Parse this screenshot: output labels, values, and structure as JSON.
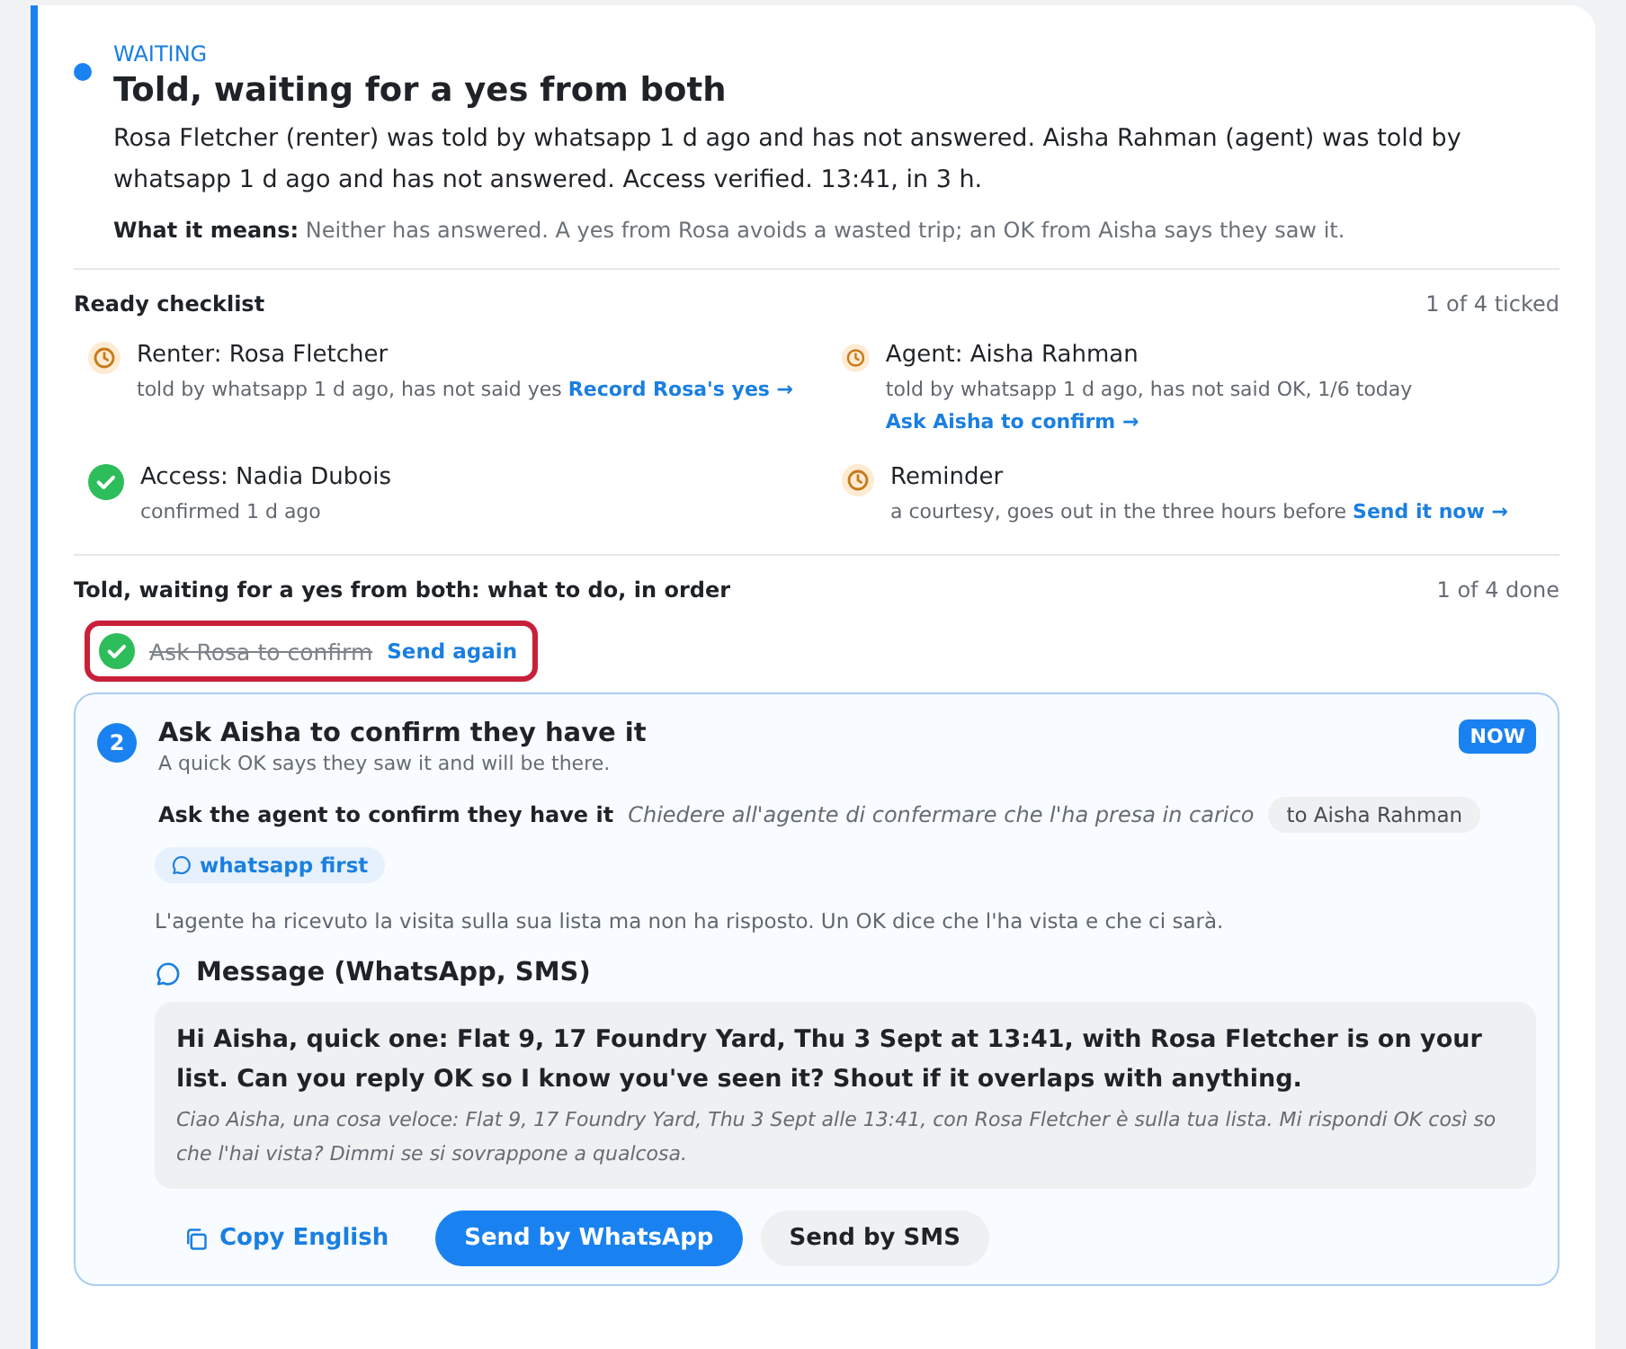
{
  "status": {
    "label": "WAITING",
    "active": true
  },
  "title": "Told, waiting for a yes from both",
  "summary": "Rosa Fletcher (renter) was told by whatsapp 1 d ago and has not answered. Aisha Rahman (agent) was told by whatsapp 1 d ago and has not answered. Access verified. 13:41, in 3 h.",
  "meaning": {
    "label": "What it means:",
    "text": "Neither has answered. A yes from Rosa avoids a wasted trip; an OK from Aisha says they saw it."
  },
  "checklist": {
    "title": "Ready checklist",
    "count": "1 of 4 ticked",
    "items": [
      {
        "title": "Renter: Rosa Fletcher",
        "detail": "told by whatsapp 1 d ago, has not said yes",
        "link": "Record Rosa's yes →",
        "done": false
      },
      {
        "title": "Agent: Aisha Rahman",
        "detail": "told by whatsapp 1 d ago, has not said OK, 1/6 today",
        "link": "Ask Aisha to confirm →",
        "done": false
      },
      {
        "title": "Access: Nadia Dubois",
        "detail": "confirmed 1 d ago",
        "done": true
      },
      {
        "title": "Reminder",
        "detail": "a courtesy, goes out in the three hours before",
        "link": "Send it now →",
        "done": false
      }
    ]
  },
  "steps": {
    "title": "Told, waiting for a yes from both: what to do, in order",
    "count": "1 of 4 done",
    "items": [
      {
        "kind": "done",
        "label": "Ask Rosa to confirm",
        "link": "Send again",
        "highlighted": true
      },
      {
        "kind": "current",
        "number": "2",
        "title": "Ask Aisha to confirm they have it",
        "subtitle": "A quick OK says they saw it and will be there.",
        "badge": "NOW",
        "task": "Ask the agent to confirm they have it",
        "task_translation": "Chiedere all'agente di confermare che l'ha presa in carico",
        "recipient": "to Aisha Rahman",
        "channel": "whatsapp first",
        "note": "L'agente ha ricevuto la visita sulla sua lista ma non ha risposto. Un OK dice che l'ha vista e che ci sarà.",
        "message": {
          "heading": "Message (WhatsApp, SMS)",
          "text": "Hi Aisha, quick one: Flat 9, 17 Foundry Yard, Thu 3 Sept at 13:41, with Rosa Fletcher is on your list. Can you reply OK so I know you've seen it? Shout if it overlaps with anything.",
          "translation": "Ciao Aisha, una cosa veloce: Flat 9, 17 Foundry Yard, Thu 3 Sept alle 13:41, con Rosa Fletcher è sulla tua lista. Mi rispondi OK così so che l'hai vista? Dimmi se si sovrappone a qualcosa."
        },
        "actions": [
          {
            "kind": "link",
            "label": "Copy English"
          },
          {
            "kind": "primary",
            "label": "Send by WhatsApp"
          },
          {
            "kind": "secondary",
            "label": "Send by SMS"
          }
        ]
      }
    ]
  }
}
